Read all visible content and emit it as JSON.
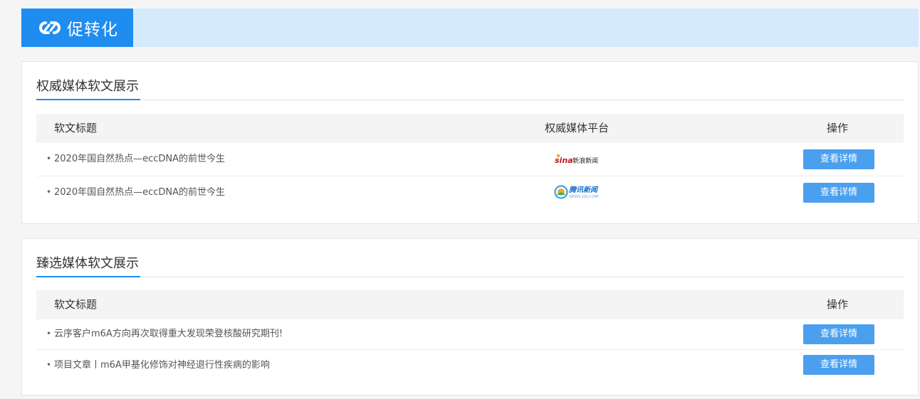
{
  "banner": {
    "title": "促转化",
    "icon": "link-icon"
  },
  "authority_section": {
    "title": "权威媒体软文展示",
    "columns": {
      "title": "软文标题",
      "platform": "权威媒体平台",
      "operation": "操作"
    },
    "rows": [
      {
        "title": "2020年国自然热点—eccDNA的前世今生",
        "platform_logo": "sina-news-logo",
        "platform_text": "sina",
        "platform_sub": "新浪新闻",
        "button": "查看详情"
      },
      {
        "title": "2020年国自然热点—eccDNA的前世今生",
        "platform_logo": "tencent-news-logo",
        "platform_text": "腾讯新闻",
        "platform_sub": "NEWS.QQ.COM",
        "button": "查看详情"
      }
    ]
  },
  "selected_section": {
    "title": "臻选媒体软文展示",
    "columns": {
      "title": "软文标题",
      "operation": "操作"
    },
    "rows": [
      {
        "title": "云序客户m6A方向再次取得重大发现荣登核酸研究期刊!",
        "button": "查看详情"
      },
      {
        "title": "项目文章丨m6A甲基化修饰对神经退行性疾病的影响",
        "button": "查看详情"
      }
    ]
  },
  "colors": {
    "accent": "#1f8cf0",
    "banner_bg": "#d6eafd",
    "button": "#4aa0ef"
  }
}
